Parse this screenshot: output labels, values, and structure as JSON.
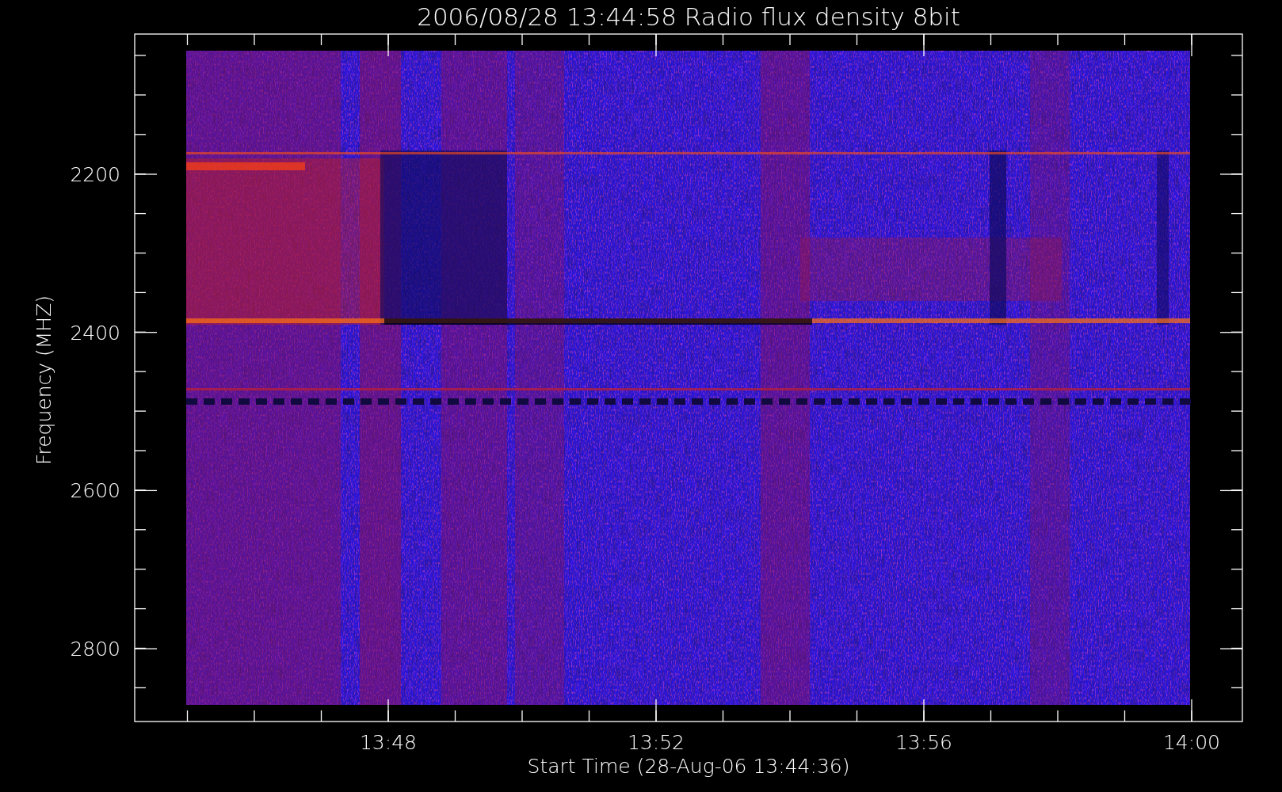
{
  "title": "2006/08/28 13:44:58 Radio flux density 8bit",
  "y_axis": {
    "label": "Frequency (MHZ)",
    "ticks": [
      "2200",
      "2400",
      "2600",
      "2800"
    ]
  },
  "x_axis": {
    "label": "Start Time (28-Aug-06 13:44:36)",
    "ticks": [
      "13:48",
      "13:52",
      "13:56",
      "14:00"
    ]
  }
}
